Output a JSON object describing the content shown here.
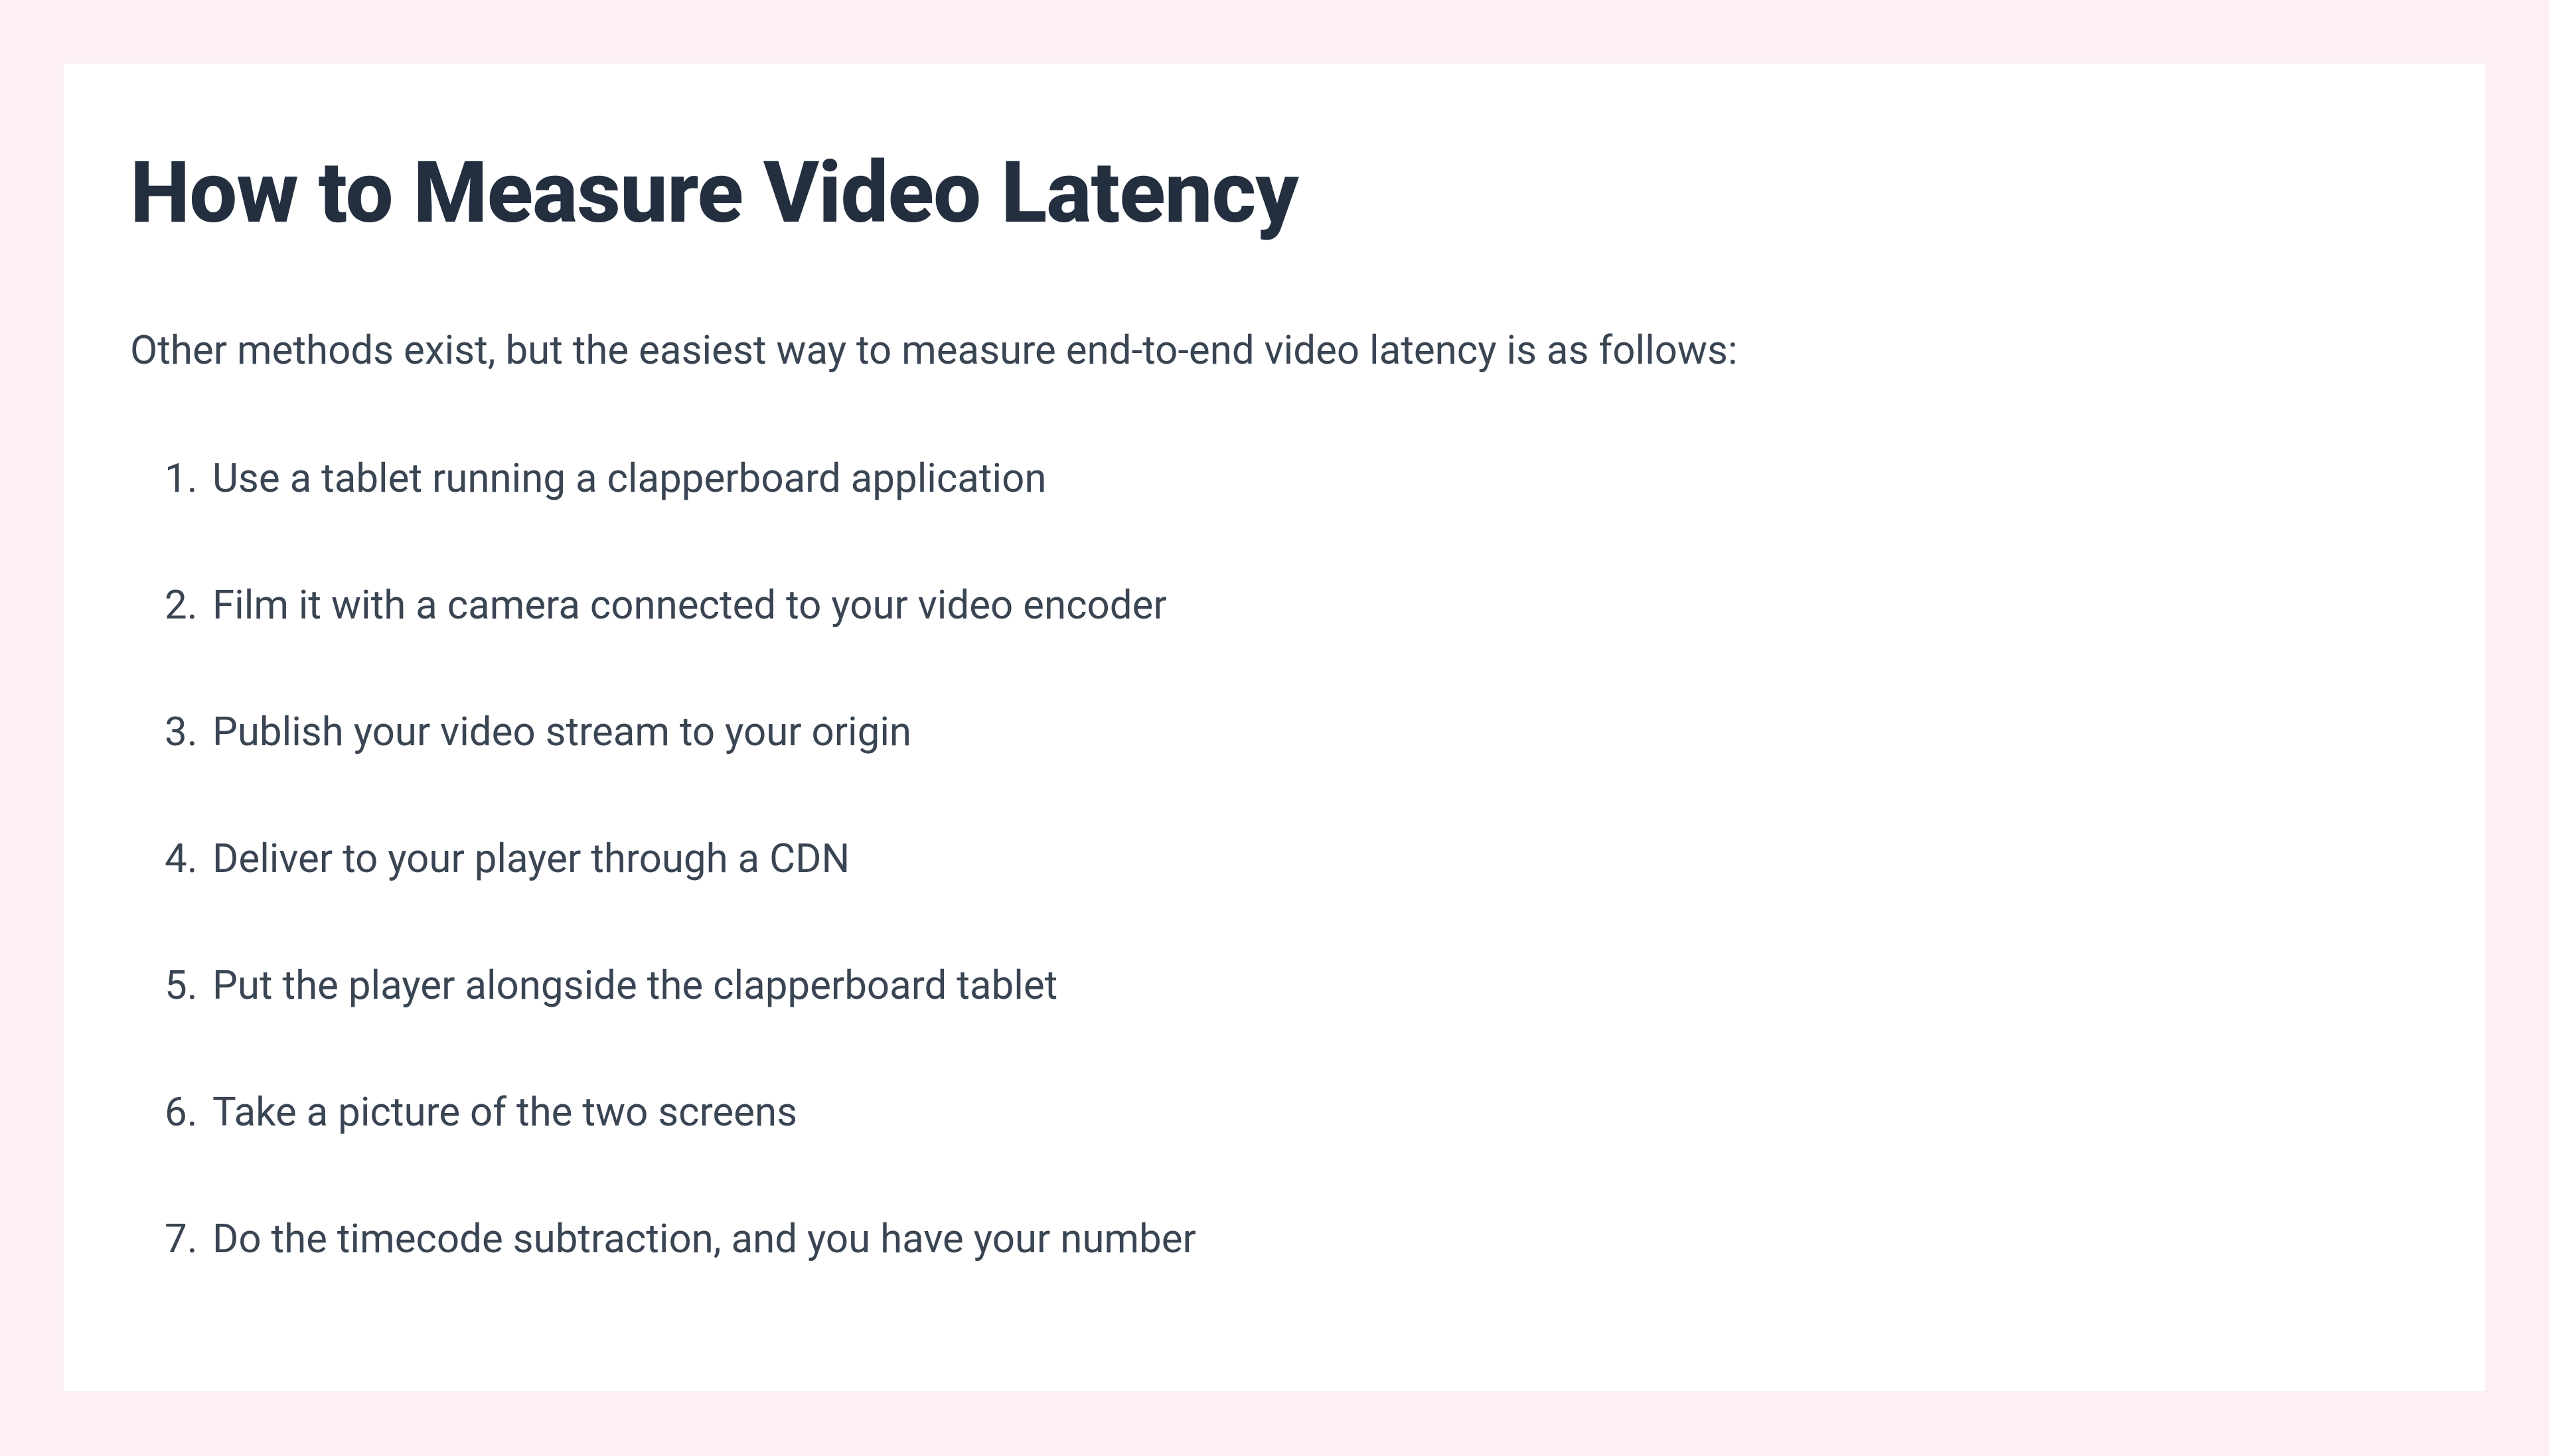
{
  "title": "How to Measure Video Latency",
  "intro": "Other methods exist, but the easiest way to measure end-to-end video latency is as follows:",
  "steps": [
    "Use a tablet running a clapperboard application",
    "Film it with a camera connected to your video encoder",
    "Publish your video stream to your origin",
    "Deliver to your player through a CDN",
    "Put the player alongside the clapperboard tablet",
    "Take a picture of the two screens",
    "Do the timecode subtraction, and you have your number"
  ]
}
